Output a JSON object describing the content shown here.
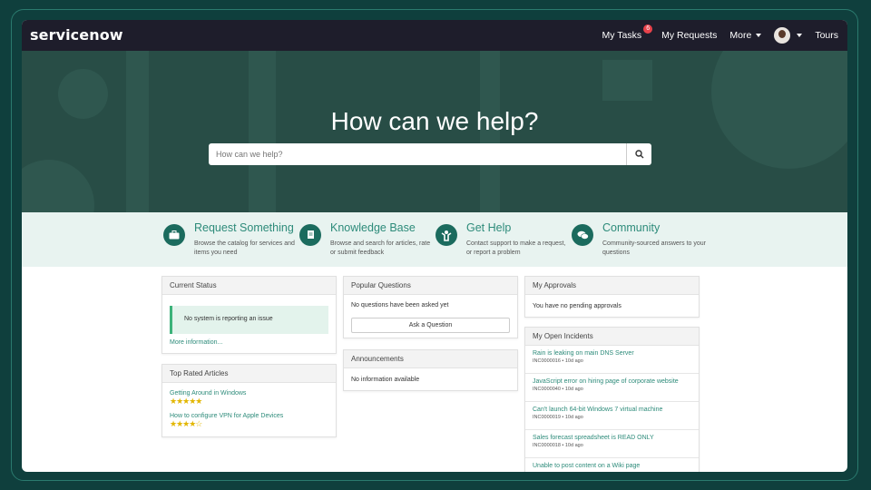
{
  "app": {
    "logo": "servicenow"
  },
  "nav": {
    "my_tasks": "My Tasks",
    "my_tasks_badge": "6",
    "my_requests": "My Requests",
    "more": "More",
    "tours": "Tours"
  },
  "hero": {
    "title": "How can we help?",
    "search_placeholder": "How can we help?"
  },
  "quick_links": [
    {
      "title": "Request Something",
      "desc": "Browse the catalog for services and items you need",
      "icon": "briefcase-icon"
    },
    {
      "title": "Knowledge Base",
      "desc": "Browse and search for articles, rate or submit feedback",
      "icon": "book-icon"
    },
    {
      "title": "Get Help",
      "desc": "Contact support to make a request, or report a problem",
      "icon": "help-person-icon"
    },
    {
      "title": "Community",
      "desc": "Community-sourced answers to your questions",
      "icon": "chat-icon"
    }
  ],
  "current_status": {
    "title": "Current Status",
    "message": "No system is reporting an issue",
    "more_link": "More information..."
  },
  "top_rated": {
    "title": "Top Rated Articles",
    "articles": [
      {
        "title": "Getting Around in Windows",
        "rating": 5
      },
      {
        "title": "How to configure VPN for Apple Devices",
        "rating": 4
      }
    ]
  },
  "popular_questions": {
    "title": "Popular Questions",
    "message": "No questions have been asked yet",
    "button": "Ask a Question"
  },
  "announcements": {
    "title": "Announcements",
    "message": "No information available"
  },
  "my_approvals": {
    "title": "My Approvals",
    "message": "You have no pending approvals"
  },
  "my_incidents": {
    "title": "My Open Incidents",
    "items": [
      {
        "title": "Rain is leaking on main DNS Server",
        "meta": "INC0000016 • 10d ago"
      },
      {
        "title": "JavaScript error on hiring page of corporate website",
        "meta": "INC0000040 • 10d ago"
      },
      {
        "title": "Can't launch 64-bit Windows 7 virtual machine",
        "meta": "INC0000019 • 10d ago"
      },
      {
        "title": "Sales forecast spreadsheet is READ ONLY",
        "meta": "INC0000018 • 10d ago"
      },
      {
        "title": "Unable to post content on a Wiki page",
        "meta": ""
      }
    ]
  },
  "colors": {
    "nav_bg": "#1e1d2b",
    "hero_bg": "#284d46",
    "accent": "#2d8b7a",
    "badge": "#e8424b"
  }
}
